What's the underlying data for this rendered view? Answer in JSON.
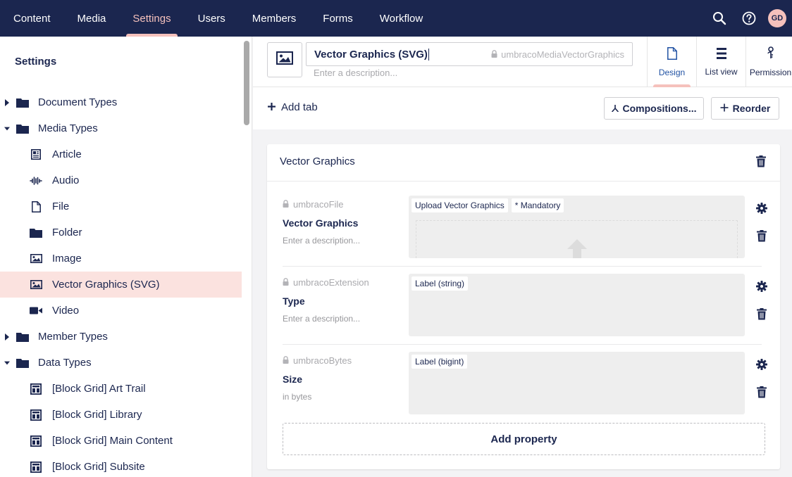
{
  "topnav": {
    "items": [
      {
        "label": "Content"
      },
      {
        "label": "Media"
      },
      {
        "label": "Settings"
      },
      {
        "label": "Users"
      },
      {
        "label": "Members"
      },
      {
        "label": "Forms"
      },
      {
        "label": "Workflow"
      }
    ],
    "active": "Settings",
    "avatar_initials": "GD"
  },
  "sidebar": {
    "title": "Settings",
    "tree": [
      {
        "label": "Document Types",
        "level": 0,
        "expanded": false,
        "icon": "folder-icon"
      },
      {
        "label": "Media Types",
        "level": 0,
        "expanded": true,
        "icon": "folder-icon"
      },
      {
        "label": "Article",
        "level": 1,
        "icon": "article-icon"
      },
      {
        "label": "Audio",
        "level": 1,
        "icon": "audio-icon"
      },
      {
        "label": "File",
        "level": 1,
        "icon": "file-icon"
      },
      {
        "label": "Folder",
        "level": 1,
        "icon": "folder-icon"
      },
      {
        "label": "Image",
        "level": 1,
        "icon": "image-icon"
      },
      {
        "label": "Vector Graphics (SVG)",
        "level": 1,
        "icon": "image-icon",
        "selected": true
      },
      {
        "label": "Video",
        "level": 1,
        "icon": "video-icon"
      },
      {
        "label": "Member Types",
        "level": 0,
        "expanded": false,
        "icon": "folder-icon"
      },
      {
        "label": "Data Types",
        "level": 0,
        "expanded": true,
        "icon": "folder-icon"
      },
      {
        "label": "[Block Grid] Art Trail",
        "level": 1,
        "icon": "grid-icon"
      },
      {
        "label": "[Block Grid] Library",
        "level": 1,
        "icon": "grid-icon"
      },
      {
        "label": "[Block Grid] Main Content",
        "level": 1,
        "icon": "grid-icon"
      },
      {
        "label": "[Block Grid] Subsite",
        "level": 1,
        "icon": "grid-icon"
      }
    ]
  },
  "editor": {
    "name": "Vector Graphics (SVG)",
    "alias": "umbracoMediaVectorGraphics",
    "description_placeholder": "Enter a description...",
    "apps": [
      {
        "label": "Design",
        "active": true,
        "icon": "document-icon"
      },
      {
        "label": "List view",
        "icon": "list-icon"
      },
      {
        "label": "Permission",
        "icon": "permissions-icon"
      }
    ]
  },
  "toolbar": {
    "add_tab": "Add tab",
    "compositions": "Compositions...",
    "reorder": "Reorder"
  },
  "group": {
    "title": "Vector Graphics",
    "properties": [
      {
        "alias": "umbracoFile",
        "name": "Vector Graphics",
        "description": "Enter a description...",
        "tags": [
          "Upload Vector Graphics",
          "* Mandatory"
        ]
      },
      {
        "alias": "umbracoExtension",
        "name": "Type",
        "description": "Enter a description...",
        "tags": [
          "Label (string)"
        ]
      },
      {
        "alias": "umbracoBytes",
        "name": "Size",
        "description": "in bytes",
        "tags": [
          "Label (bigint)"
        ]
      }
    ],
    "add_property": "Add property"
  },
  "colors": {
    "nav_bg": "#1b264f",
    "accent": "#f5c1bc",
    "selected_bg": "#fbe2df",
    "active_app": "#2152a3"
  }
}
